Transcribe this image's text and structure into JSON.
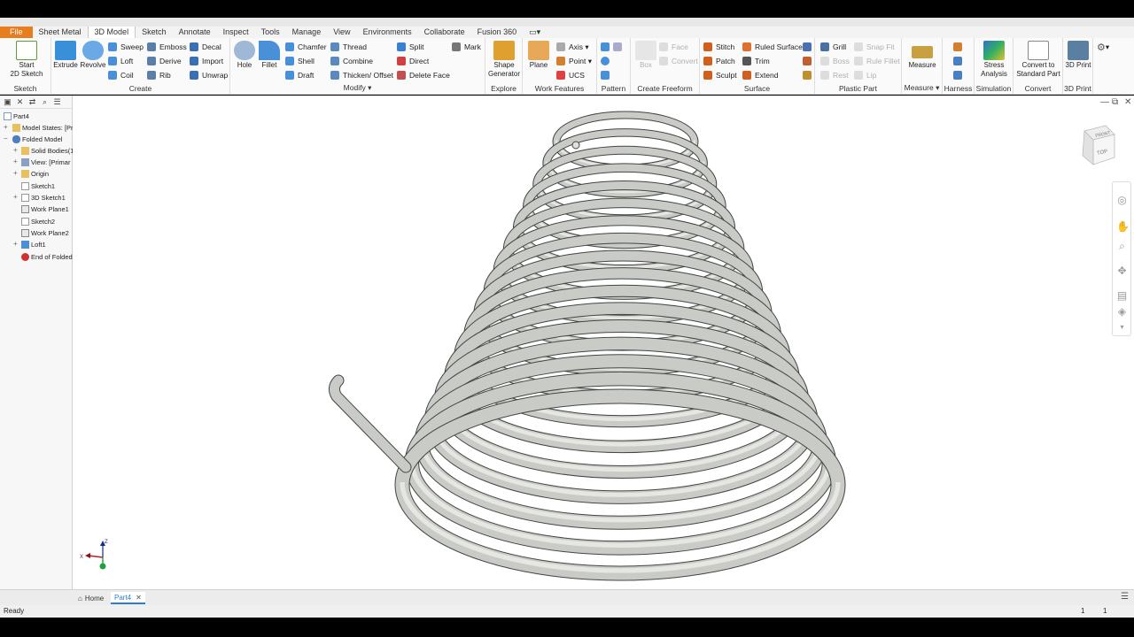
{
  "menu": {
    "tabs": [
      "File",
      "Sheet Metal",
      "3D Model",
      "Sketch",
      "Annotate",
      "Inspect",
      "Tools",
      "Manage",
      "View",
      "Environments",
      "Collaborate",
      "Fusion 360"
    ],
    "active": "3D Model"
  },
  "ribbon": {
    "sketch": {
      "title": "Sketch",
      "start": "Start",
      "start2": "2D Sketch"
    },
    "create": {
      "title": "Create",
      "extrude": "Extrude",
      "revolve": "Revolve",
      "sweep": "Sweep",
      "loft": "Loft",
      "coil": "Coil",
      "emboss": "Emboss",
      "derive": "Derive",
      "rib": "Rib",
      "decal": "Decal",
      "import": "Import",
      "unwrap": "Unwrap"
    },
    "modify": {
      "title": "Modify",
      "hole": "Hole",
      "fillet": "Fillet",
      "chamfer": "Chamfer",
      "shell": "Shell",
      "draft": "Draft",
      "thread": "Thread",
      "combine": "Combine",
      "thicken": "Thicken/ Offset",
      "split": "Split",
      "direct": "Direct",
      "delete_face": "Delete Face",
      "mark": "Mark"
    },
    "explore": {
      "title": "Explore",
      "shape1": "Shape",
      "shape2": "Generator"
    },
    "work": {
      "title": "Work Features",
      "plane": "Plane",
      "axis": "Axis",
      "point": "Point",
      "ucs": "UCS"
    },
    "pattern": {
      "title": "Pattern"
    },
    "freeform": {
      "title": "Create Freeform",
      "box": "Box",
      "face": "Face",
      "convert": "Convert"
    },
    "surface": {
      "title": "Surface",
      "stitch": "Stitch",
      "patch": "Patch",
      "sculpt": "Sculpt",
      "ruled": "Ruled Surface",
      "trim": "Trim",
      "extend": "Extend"
    },
    "plastic": {
      "title": "Plastic Part",
      "grill": "Grill",
      "boss": "Boss",
      "rest": "Rest",
      "snap": "Snap Fit",
      "rule_fillet": "Rule Fillet",
      "lip": "Lip"
    },
    "measure": {
      "title": "Measure",
      "btn": "Measure"
    },
    "harness": {
      "title": "Harness"
    },
    "simulation": {
      "title": "Simulation",
      "btn1": "Stress",
      "btn2": "Analysis"
    },
    "convert": {
      "title": "Convert",
      "btn1": "Convert to",
      "btn2": "Standard Part"
    },
    "print3d": {
      "title": "3D Print",
      "btn": "3D Print"
    }
  },
  "browser": {
    "items": [
      {
        "label": "Part4",
        "level": 0
      },
      {
        "label": "Model States: [Pr",
        "level": 1
      },
      {
        "label": "Folded Model",
        "level": 0
      },
      {
        "label": "Solid Bodies(1",
        "level": 2
      },
      {
        "label": "View: [Primar",
        "level": 2
      },
      {
        "label": "Origin",
        "level": 2
      },
      {
        "label": "Sketch1",
        "level": 2
      },
      {
        "label": "3D Sketch1",
        "level": 2
      },
      {
        "label": "Work Plane1",
        "level": 2
      },
      {
        "label": "Sketch2",
        "level": 2
      },
      {
        "label": "Work Plane2",
        "level": 2
      },
      {
        "label": "Loft1",
        "level": 2
      },
      {
        "label": "End of Folded",
        "level": 2
      }
    ]
  },
  "viewcube": {
    "front": "FRONT",
    "top": "TOP"
  },
  "triad": {
    "x": "X",
    "z": "Z"
  },
  "doc_tabs": {
    "home": "Home",
    "part": "Part4"
  },
  "status": {
    "text": "Ready",
    "num1": "1",
    "num2": "1"
  },
  "colors": {
    "accent": "#2a7fd4",
    "file_tab": "#e87d1e",
    "model": "#c9cbc6"
  }
}
